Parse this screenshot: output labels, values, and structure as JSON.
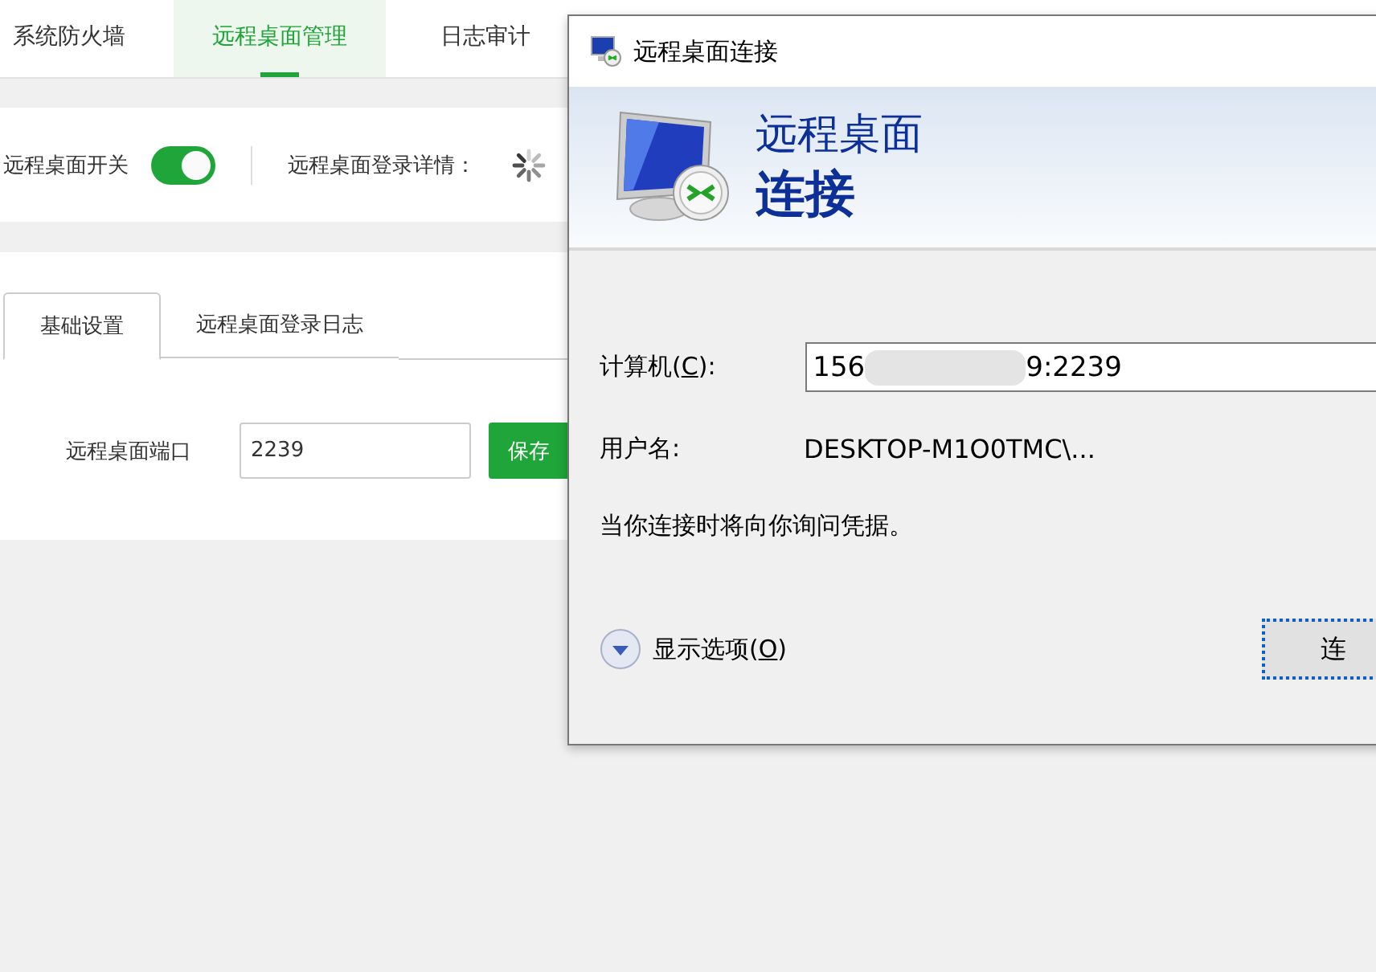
{
  "top_tabs": [
    {
      "label": "系统防火墙",
      "selected": false
    },
    {
      "label": "远程桌面管理",
      "selected": true
    },
    {
      "label": "日志审计",
      "selected": false
    }
  ],
  "status_row": {
    "switch_label": "远程桌面开关",
    "switch_on": true,
    "details_label": "远程桌面登录详情："
  },
  "sub_tabs": [
    {
      "label": "基础设置",
      "selected": true
    },
    {
      "label": "远程桌面登录日志",
      "selected": false
    }
  ],
  "port_form": {
    "label": "远程桌面端口",
    "value": "2239",
    "save_button": "保存"
  },
  "dialog": {
    "title": "远程桌面连接",
    "banner_line_1": "远程桌面",
    "banner_line_2": "连接",
    "computer": {
      "label_before": "计算机(",
      "access_key": "C",
      "label_after": "):",
      "value_start": "156",
      "value_end": "9:2239"
    },
    "user": {
      "label": "用户名:",
      "value": "DESKTOP-M1O0TMC\\..."
    },
    "note": "当你连接时将向你询问凭据。",
    "options": {
      "label_before": "显示选项(",
      "access_key": "O",
      "label_after": ")",
      "expanded": false
    },
    "connect_button": "连"
  }
}
